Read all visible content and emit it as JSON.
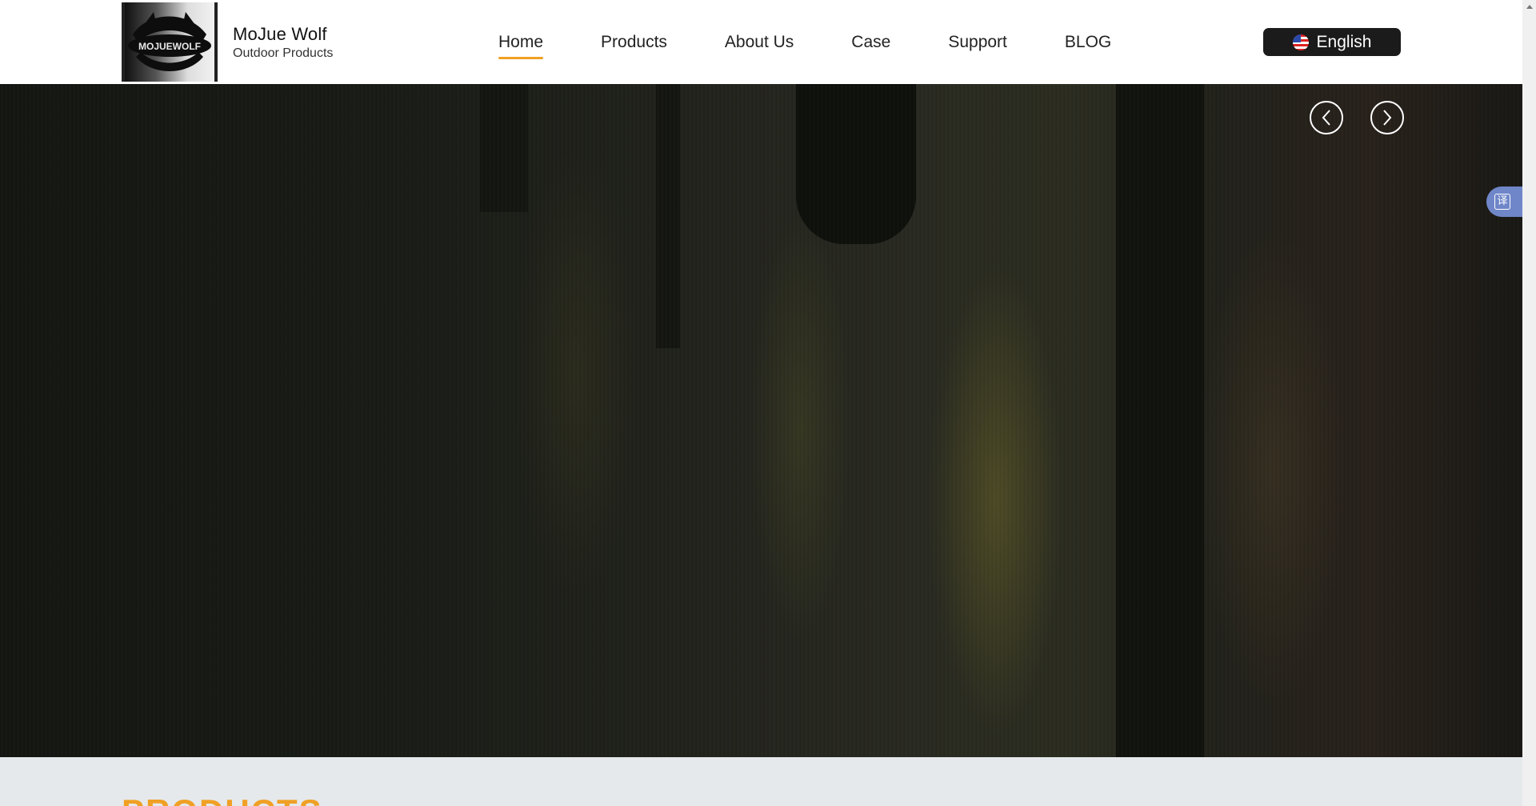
{
  "brand": {
    "logo_text": "MOJUEWOLF",
    "name": "MoJue Wolf",
    "tagline": "Outdoor Products"
  },
  "nav": {
    "items": [
      {
        "label": "Home",
        "active": true
      },
      {
        "label": "Products",
        "active": false
      },
      {
        "label": "About Us",
        "active": false
      },
      {
        "label": "Case",
        "active": false
      },
      {
        "label": "Support",
        "active": false
      },
      {
        "label": "BLOG",
        "active": false
      }
    ]
  },
  "language": {
    "label": "English",
    "flag_icon": "us-flag-icon"
  },
  "hero": {
    "prev_icon": "chevron-left-icon",
    "next_icon": "chevron-right-icon"
  },
  "translate": {
    "glyph": "译"
  },
  "section": {
    "title": "PRODUCTS"
  },
  "colors": {
    "accent": "#f0a024",
    "lang_button_bg": "#1b1b1b",
    "translate_tab_bg": "#6f86c8",
    "section_bg": "#e5e9ec"
  }
}
